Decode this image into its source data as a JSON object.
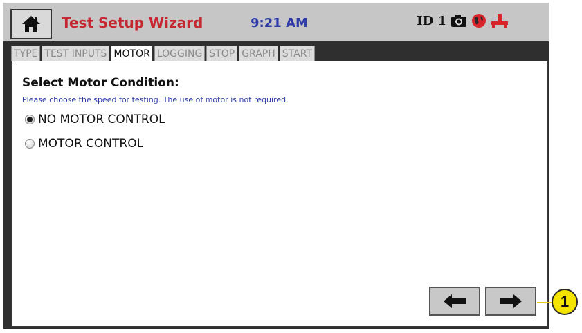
{
  "header": {
    "title": "Test Setup Wizard",
    "time": "9:21 AM",
    "id_label": "ID 1",
    "home_icon": "home-icon",
    "camera_icon": "camera-icon",
    "globe_icon": "globe-icon",
    "load_frame_icon": "load-frame-icon"
  },
  "tabs": [
    {
      "label": "TYPE",
      "active": false
    },
    {
      "label": "TEST INPUTS",
      "active": false
    },
    {
      "label": "MOTOR",
      "active": true
    },
    {
      "label": "LOGGING",
      "active": false
    },
    {
      "label": "STOP",
      "active": false
    },
    {
      "label": "GRAPH",
      "active": false
    },
    {
      "label": "START",
      "active": false
    }
  ],
  "main": {
    "heading": "Select Motor Condition:",
    "hint": "Please choose the speed for testing.  The use of motor is not required.",
    "options": [
      {
        "label": "NO MOTOR CONTROL",
        "checked": true
      },
      {
        "label": "MOTOR CONTROL",
        "checked": false
      }
    ]
  },
  "nav": {
    "back_icon": "arrow-left-icon",
    "next_icon": "arrow-right-icon"
  },
  "callout": {
    "number": "1"
  },
  "colors": {
    "title_red": "#c62630",
    "clock_blue": "#2d3aa8",
    "callout_yellow": "#f5e400"
  }
}
